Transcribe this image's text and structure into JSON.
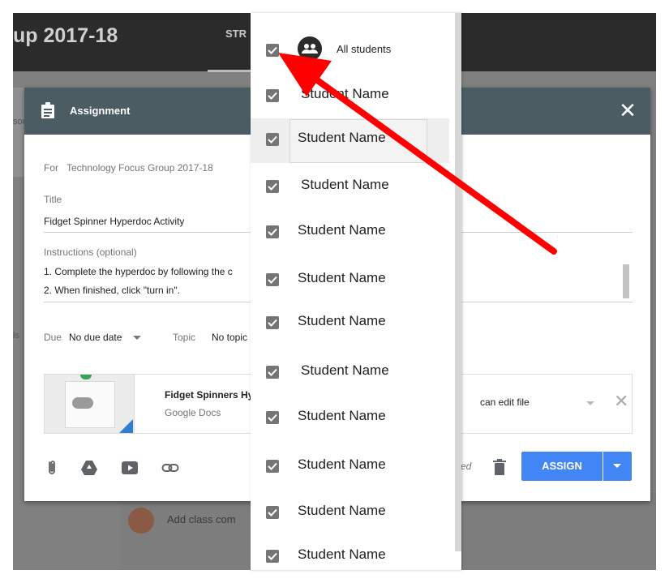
{
  "background": {
    "class_title": "up 2017-18",
    "stream_tab": "STR",
    "comment_placeholder": "Add class com",
    "left_text_1": "soc",
    "left_text_2": "ls"
  },
  "dialog": {
    "title": "Assignment",
    "close": "✕",
    "for_label": "For",
    "for_value": "Technology Focus Group 2017-18",
    "title_label": "Title",
    "title_value": "Fidget Spinner Hyperdoc Activity",
    "instructions_label": "Instructions (optional)",
    "instructions_line1": "1. Complete the hyperdoc by following the c",
    "instructions_line2": "2. When finished, click \"turn in\".",
    "due_label": "Due",
    "due_value": "No due date",
    "topic_label": "Topic",
    "topic_value": "No topic",
    "attachment": {
      "name": "Fidget Spinners Hyper",
      "type": "Google Docs",
      "permission": "can edit file",
      "remove": "✕"
    },
    "saved_text": "ved",
    "assign_label": "ASSIGN"
  },
  "student_dropdown": {
    "all_label": "All students",
    "students": [
      "Student Name",
      "Student Name",
      "Student Name",
      "Student Name",
      "Student Name",
      "Student Name",
      "Student Name",
      "Student Name",
      "Student Name",
      "Student Name",
      "Student Name"
    ]
  },
  "colors": {
    "accent": "#4285f4",
    "header": "#4b5c63",
    "arrow": "#ff0000"
  }
}
